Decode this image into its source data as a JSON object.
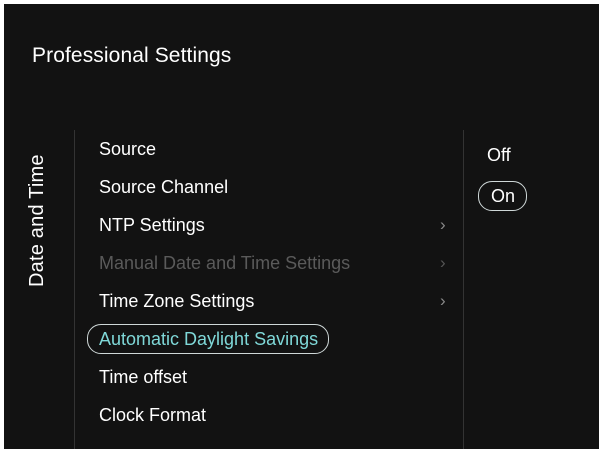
{
  "header": {
    "title": "Professional Settings"
  },
  "category": {
    "label": "Date and Time"
  },
  "menu": {
    "items": [
      {
        "label": "Source",
        "state": "normal",
        "has_submenu": false
      },
      {
        "label": "Source Channel",
        "state": "normal",
        "has_submenu": false
      },
      {
        "label": "NTP Settings",
        "state": "normal",
        "has_submenu": true
      },
      {
        "label": "Manual Date and Time Settings",
        "state": "disabled",
        "has_submenu": true
      },
      {
        "label": "Time Zone Settings",
        "state": "normal",
        "has_submenu": true
      },
      {
        "label": "Automatic Daylight Savings",
        "state": "selected",
        "has_submenu": false
      },
      {
        "label": "Time offset",
        "state": "normal",
        "has_submenu": false
      },
      {
        "label": "Clock Format",
        "state": "normal",
        "has_submenu": false
      }
    ],
    "chevron_glyph": "›"
  },
  "options": {
    "items": [
      {
        "label": "Off",
        "selected": false
      },
      {
        "label": "On",
        "selected": true
      }
    ]
  },
  "colors": {
    "background": "#121212",
    "text": "#ffffff",
    "disabled_text": "#5a5a5a",
    "selected_text": "#7fd8d8",
    "highlight_border": "#cfd8d8"
  },
  "icons": {
    "submenu": "chevron-right-icon"
  }
}
